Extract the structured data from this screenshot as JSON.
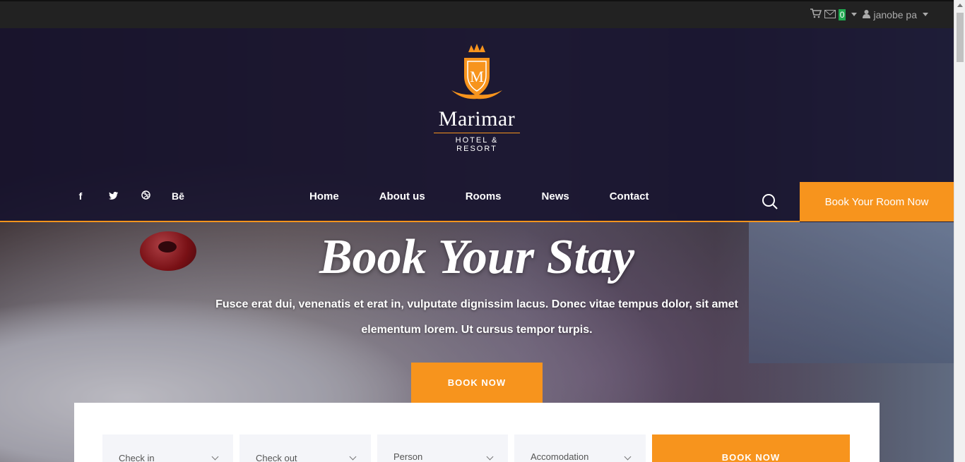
{
  "topbar": {
    "cart_icon": "shopping-cart-icon",
    "mail_icon": "envelope-icon",
    "message_count": "0",
    "user_icon": "user-icon",
    "user_name": "janobe pa"
  },
  "brand": {
    "name": "Marimar",
    "tagline": "HOTEL & RESORT",
    "accent": "#f7941d"
  },
  "social": [
    "f",
    "🐦",
    "◎",
    "Bē"
  ],
  "nav": {
    "items": [
      "Home",
      "About us",
      "Rooms",
      "News",
      "Contact"
    ],
    "cta": "Book Your Room Now"
  },
  "hero": {
    "title": "Book Your Stay",
    "text": "Fusce erat dui, venenatis et erat in, vulputate dignissim lacus. Donec vitae tempus dolor, sit amet elementum lorem. Ut cursus tempor turpis.",
    "button": "BOOK NOW"
  },
  "booking": {
    "checkin": "Check in",
    "checkout": "Check out",
    "person": "Person",
    "accommodation": "Accomodation",
    "button": "BOOK NOW"
  }
}
